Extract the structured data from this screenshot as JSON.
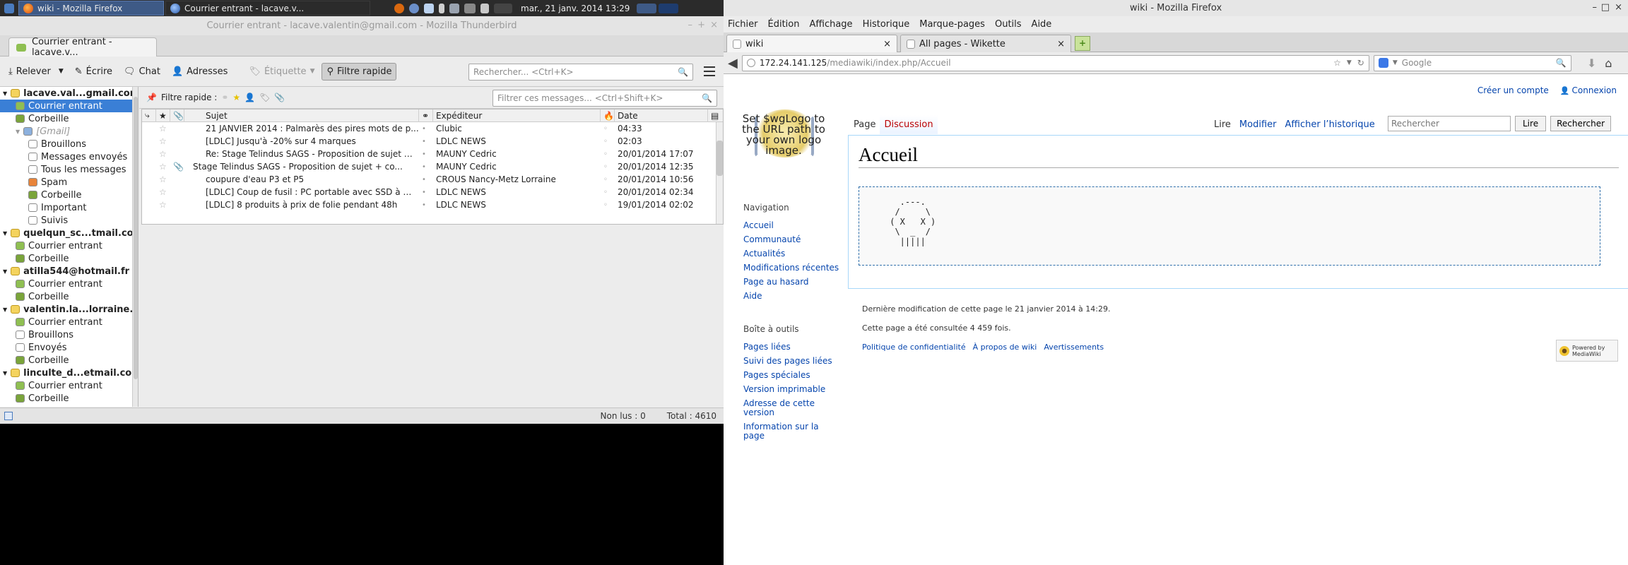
{
  "panel": {
    "tasks": [
      {
        "label": "wiki - Mozilla Firefox",
        "active": true
      },
      {
        "label": "Courrier entrant - lacave.v...",
        "active": false
      }
    ],
    "clock": "mar., 21 janv. 2014 13:29"
  },
  "thunderbird": {
    "title": "Courrier entrant - lacave.valentin@gmail.com - Mozilla Thunderbird",
    "tab_label": "Courrier entrant - lacave.v...",
    "toolbar": {
      "relever": "Relever",
      "ecrire": "Écrire",
      "chat": "Chat",
      "adresses": "Adresses",
      "etiquette": "Étiquette",
      "filtre_rapide": "Filtre rapide",
      "search_placeholder": "Rechercher... <Ctrl+K>"
    },
    "folders": [
      {
        "label": "lacave.val...gmail.com",
        "type": "account",
        "indent": 0
      },
      {
        "label": "Courrier entrant",
        "type": "inbox",
        "indent": 1,
        "selected": true
      },
      {
        "label": "Corbeille",
        "type": "trash",
        "indent": 1
      },
      {
        "label": "[Gmail]",
        "type": "gmail",
        "indent": 1
      },
      {
        "label": "Brouillons",
        "type": "folder",
        "indent": 2
      },
      {
        "label": "Messages envoyés",
        "type": "folder",
        "indent": 2
      },
      {
        "label": "Tous les messages",
        "type": "folder",
        "indent": 2
      },
      {
        "label": "Spam",
        "type": "spam",
        "indent": 2
      },
      {
        "label": "Corbeille",
        "type": "trash",
        "indent": 2
      },
      {
        "label": "Important",
        "type": "folder",
        "indent": 2
      },
      {
        "label": "Suivis",
        "type": "folder",
        "indent": 2
      },
      {
        "label": "quelqun_sc...tmail.com",
        "type": "account",
        "indent": 0
      },
      {
        "label": "Courrier entrant",
        "type": "inbox",
        "indent": 1
      },
      {
        "label": "Corbeille",
        "type": "trash",
        "indent": 1
      },
      {
        "label": "atilla544@hotmail.fr",
        "type": "account",
        "indent": 0
      },
      {
        "label": "Courrier entrant",
        "type": "inbox",
        "indent": 1
      },
      {
        "label": "Corbeille",
        "type": "trash",
        "indent": 1
      },
      {
        "label": "valentin.la...lorraine.fr",
        "type": "account",
        "indent": 0
      },
      {
        "label": "Courrier entrant",
        "type": "inbox",
        "indent": 1
      },
      {
        "label": "Brouillons",
        "type": "folder",
        "indent": 1
      },
      {
        "label": "Envoyés",
        "type": "folder",
        "indent": 1
      },
      {
        "label": "Corbeille",
        "type": "trash",
        "indent": 1
      },
      {
        "label": "linculte_d...etmail.com",
        "type": "account",
        "indent": 0
      },
      {
        "label": "Courrier entrant",
        "type": "inbox",
        "indent": 1
      },
      {
        "label": "Corbeille",
        "type": "trash",
        "indent": 1
      }
    ],
    "quickfilter_label": "Filtre rapide :",
    "filter_placeholder": "Filtrer ces messages... <Ctrl+Shift+K>",
    "columns": {
      "subject": "Sujet",
      "sender": "Expéditeur",
      "date": "Date"
    },
    "messages": [
      {
        "subject": "21 JANVIER 2014 : Palmarès des pires mots de p...",
        "sender": "Clubic",
        "date": "04:33",
        "attach": false,
        "tag": false
      },
      {
        "subject": "[LDLC] Jusqu'à -20% sur 4 marques",
        "sender": "LDLC NEWS",
        "date": "02:03",
        "attach": false,
        "tag": false
      },
      {
        "subject": "Re: Stage Telindus SAGS - Proposition de sujet + ...",
        "sender": "MAUNY Cedric",
        "date": "20/01/2014 17:07",
        "attach": false,
        "tag": false
      },
      {
        "subject": "Stage Telindus SAGS - Proposition de sujet + co...",
        "sender": "MAUNY Cedric",
        "date": "20/01/2014 12:35",
        "attach": true,
        "tag": true
      },
      {
        "subject": "coupure d'eau P3 et P5",
        "sender": "CROUS Nancy-Metz Lorraine",
        "date": "20/01/2014 10:56",
        "attach": false,
        "tag": false
      },
      {
        "subject": "[LDLC] Coup de fusil : PC portable avec SSD à mo...",
        "sender": "LDLC NEWS",
        "date": "20/01/2014 02:34",
        "attach": false,
        "tag": false
      },
      {
        "subject": "[LDLC] 8 produits à prix de folie pendant 48h",
        "sender": "LDLC NEWS",
        "date": "19/01/2014 02:02",
        "attach": false,
        "tag": false
      }
    ],
    "status": {
      "unread": "Non lus : 0",
      "total": "Total : 4610"
    }
  },
  "firefox": {
    "title": "wiki - Mozilla Firefox",
    "menu": [
      "Fichier",
      "Édition",
      "Affichage",
      "Historique",
      "Marque-pages",
      "Outils",
      "Aide"
    ],
    "tabs": [
      {
        "label": "wiki",
        "active": true
      },
      {
        "label": "All pages - Wikette",
        "active": false
      }
    ],
    "url_host": "172.24.141.125",
    "url_path": "/mediawiki/index.php/Accueil",
    "search_engine_placeholder": "Google"
  },
  "wiki": {
    "logo_text": "Set $wgLogo to the URL path to your own logo image.",
    "personal": {
      "create": "Créer un compte",
      "login": "Connexion"
    },
    "ns_tabs": {
      "page": "Page",
      "discussion": "Discussion"
    },
    "view_tabs": {
      "read": "Lire",
      "edit": "Modifier",
      "history": "Afficher l’historique"
    },
    "search_placeholder": "Rechercher",
    "btn_go": "Lire",
    "btn_search": "Rechercher",
    "heading": "Accueil",
    "ascii_art": "   .---.\n  /     \\\n ( X   X )\n  \\  _  /\n   |||||",
    "nav_title": "Navigation",
    "nav_links": [
      "Accueil",
      "Communauté",
      "Actualités",
      "Modifications récentes",
      "Page au hasard",
      "Aide"
    ],
    "tools_title": "Boîte à outils",
    "tools_links": [
      "Pages liées",
      "Suivi des pages liées",
      "Pages spéciales",
      "Version imprimable",
      "Adresse de cette version",
      "Information sur la page"
    ],
    "footer_lastmod": "Dernière modification de cette page le 21 janvier 2014 à 14:29.",
    "footer_views": "Cette page a été consultée 4 459 fois.",
    "footer_links": [
      "Politique de confidentialité",
      "À propos de wiki",
      "Avertissements"
    ],
    "powered": "Powered by MediaWiki"
  },
  "colors": {
    "accent": "#3a7fd6",
    "link": "#0645ad",
    "new_link": "#ba0000",
    "panel": "#2b2b2b"
  }
}
